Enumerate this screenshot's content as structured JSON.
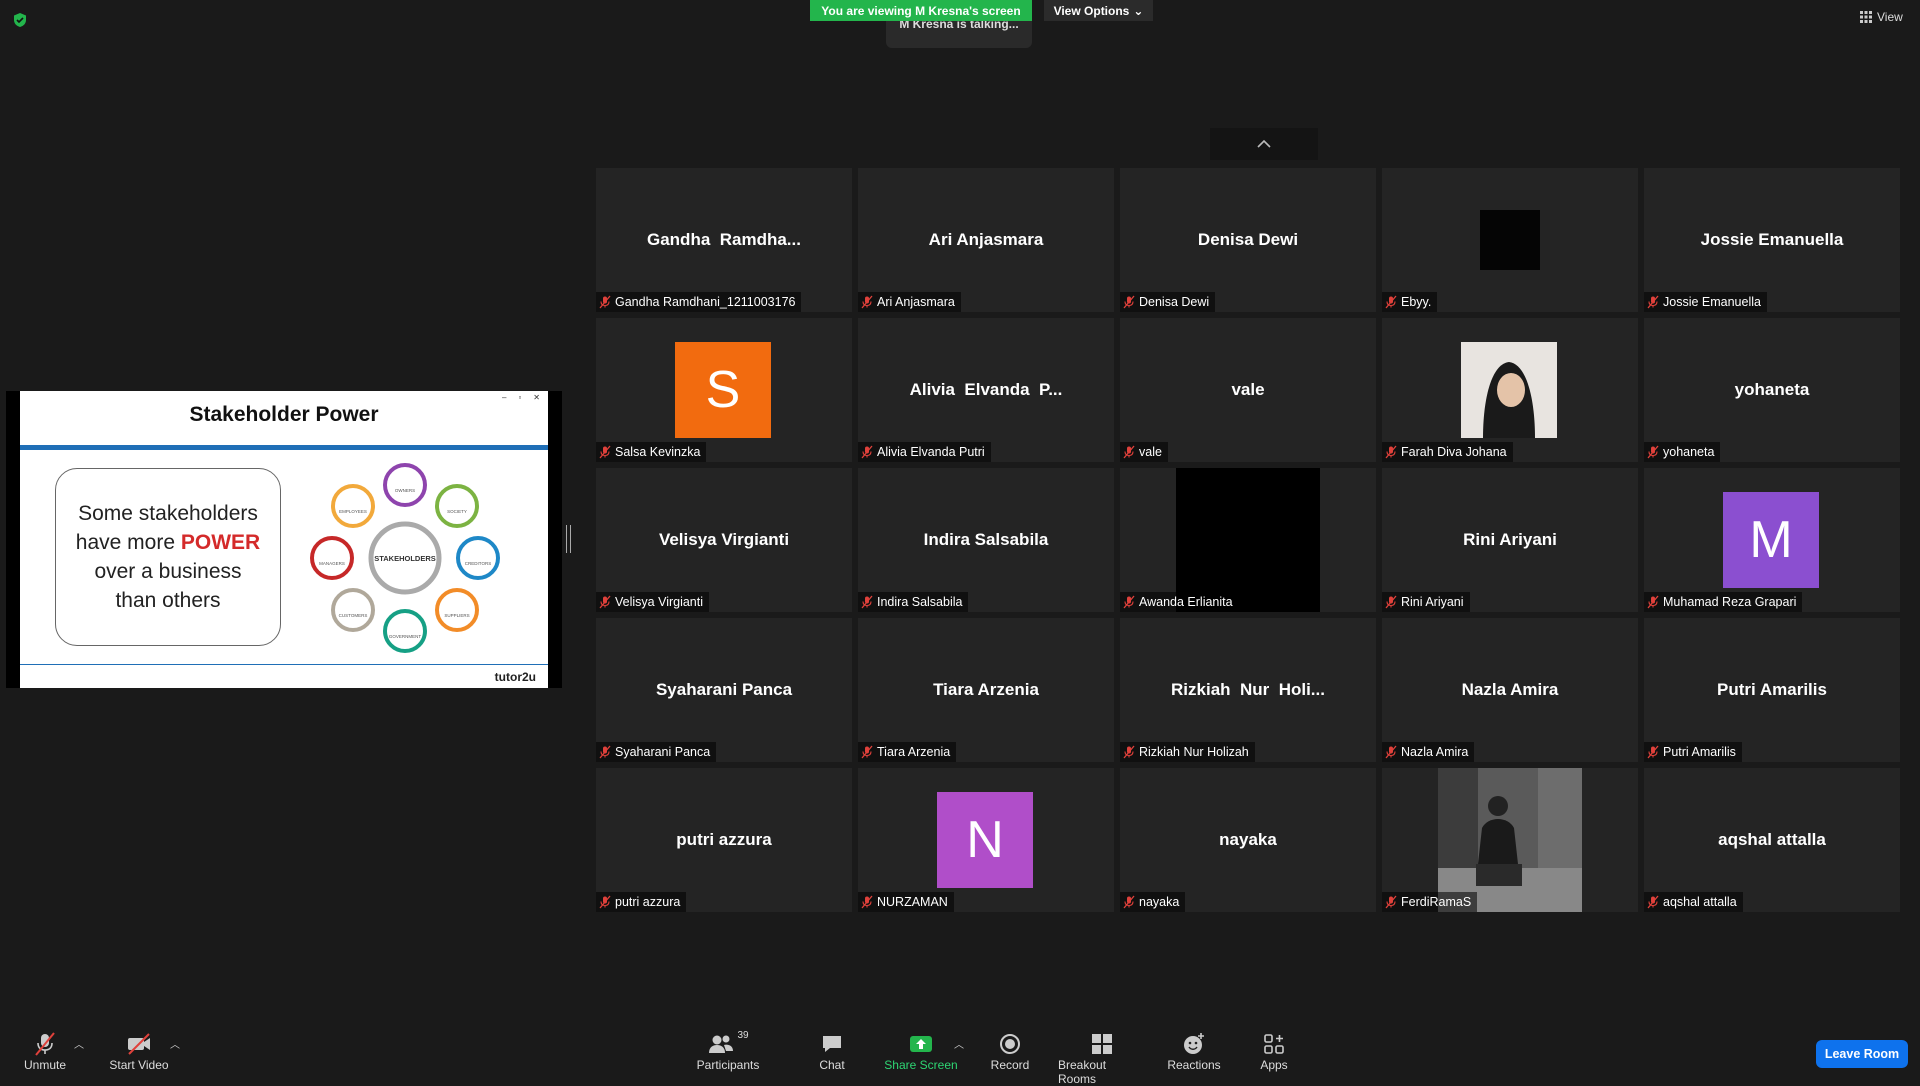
{
  "top": {
    "banner": "You are viewing M Kresna's screen",
    "view_options": "View Options",
    "talking": "M Kresna is talking...",
    "view": "View"
  },
  "slide": {
    "title": "Stakeholder Power",
    "text_1": "Some stakeholders",
    "text_2a": "have more ",
    "text_2b": "POWER",
    "text_3": "over a business",
    "text_4": "than others",
    "center": "STAKEHOLDERS",
    "nodes": [
      "OWNERS",
      "SOCIETY",
      "CREDITORS",
      "SUPPLIERS",
      "GOVERNMENT",
      "CUSTOMERS",
      "MANAGERS",
      "EMPLOYEES"
    ],
    "brand": "tutor2u"
  },
  "participants": [
    {
      "name": "Gandha  Ramdha...",
      "label": "Gandha Ramdhani_1211003176"
    },
    {
      "name": "Ari Anjasmara",
      "label": "Ari Anjasmara"
    },
    {
      "name": "Denisa Dewi",
      "label": "Denisa Dewi"
    },
    {
      "name": "",
      "label": "Ebyy."
    },
    {
      "name": "Jossie Emanuella",
      "label": "Jossie Emanuella"
    },
    {
      "name": "",
      "label": "Salsa Kevinzka",
      "avatar": "S",
      "avatar_color": "#f26b0f"
    },
    {
      "name": "Alivia  Elvanda  P...",
      "label": "Alivia Elvanda Putri"
    },
    {
      "name": "vale",
      "label": "vale"
    },
    {
      "name": "",
      "label": "Farah Diva Johana"
    },
    {
      "name": "yohaneta",
      "label": "yohaneta"
    },
    {
      "name": "Velisya Virgianti",
      "label": "Velisya Virgianti"
    },
    {
      "name": "Indira Salsabila",
      "label": "Indira Salsabila"
    },
    {
      "name": "",
      "label": "Awanda Erlianita"
    },
    {
      "name": "Rini Ariyani",
      "label": "Rini Ariyani"
    },
    {
      "name": "",
      "label": "Muhamad Reza Grapari",
      "avatar": "M",
      "avatar_color": "#8b4fd0"
    },
    {
      "name": "Syaharani Panca",
      "label": "Syaharani Panca"
    },
    {
      "name": "Tiara Arzenia",
      "label": "Tiara Arzenia"
    },
    {
      "name": "Rizkiah  Nur  Holi...",
      "label": "Rizkiah Nur Holizah"
    },
    {
      "name": "Nazla Amira",
      "label": "Nazla Amira"
    },
    {
      "name": "Putri Amarilis",
      "label": "Putri Amarilis"
    },
    {
      "name": "putri azzura",
      "label": "putri azzura"
    },
    {
      "name": "",
      "label": "NURZAMAN",
      "avatar": "N",
      "avatar_color": "#b04ec9"
    },
    {
      "name": "nayaka",
      "label": "nayaka"
    },
    {
      "name": "",
      "label": "FerdiRamaS"
    },
    {
      "name": "aqshal attalla",
      "label": "aqshal attalla"
    }
  ],
  "toolbar": {
    "unmute": "Unmute",
    "start_video": "Start Video",
    "participants": "Participants",
    "participant_count": "39",
    "chat": "Chat",
    "share_screen": "Share Screen",
    "record": "Record",
    "breakout_rooms": "Breakout Rooms",
    "reactions": "Reactions",
    "apps": "Apps",
    "leave": "Leave Room"
  },
  "colors": {
    "banner": "#23b54c",
    "leave": "#0e72ed",
    "mic_off": "#e0413b",
    "slide_bar": "#1f6fb7",
    "power": "#d42a2a"
  }
}
